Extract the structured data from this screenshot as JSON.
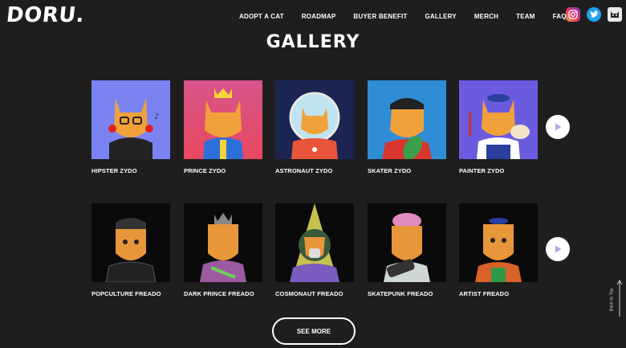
{
  "brand": {
    "logo_text": "DORU."
  },
  "nav": {
    "items": [
      "ADOPT A CAT",
      "ROADMAP",
      "BUYER BENEFIT",
      "GALLERY",
      "MERCH",
      "TEAM",
      "FAQ"
    ]
  },
  "social": {
    "icons": [
      "instagram-icon",
      "twitter-icon",
      "cat-face-icon"
    ]
  },
  "gallery": {
    "title": "GALLERY",
    "row1": [
      {
        "name": "HIPSTER ZYDO",
        "bg": "#7b83f2"
      },
      {
        "name": "PRINCE ZYDO",
        "bg": "#e34d86"
      },
      {
        "name": "ASTRONAUT ZYDO",
        "bg": "#1c2452"
      },
      {
        "name": "SKATER ZYDO",
        "bg": "#2f8dd6"
      },
      {
        "name": "PAINTER ZYDO",
        "bg": "#6a5be0"
      }
    ],
    "row2": [
      {
        "name": "POPCULTURE FREADO",
        "bg": "#0a0a0a"
      },
      {
        "name": "DARK PRINCE FREADO",
        "bg": "#0a0a0a"
      },
      {
        "name": "COSMONAUT FREADO",
        "bg": "#0a0a0a"
      },
      {
        "name": "SKATEPUNK FREADO",
        "bg": "#0a0a0a"
      },
      {
        "name": "ARTIST FREADO",
        "bg": "#0a0a0a"
      }
    ],
    "see_more": "SEE MORE"
  },
  "back_to_top": "Back to Top"
}
